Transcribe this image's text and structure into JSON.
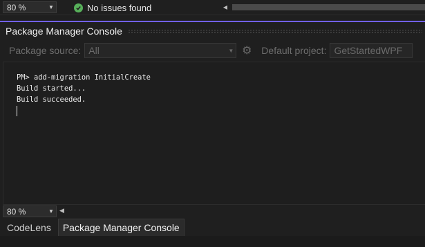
{
  "editor_status": {
    "zoom": "80 %",
    "issues_text": "No issues found"
  },
  "tool_window": {
    "title": "Package Manager Console",
    "package_source_label": "Package source:",
    "package_source_value": "All",
    "default_project_label": "Default project:",
    "default_project_value": "GetStartedWPF"
  },
  "console": {
    "lines": [
      "PM> add-migration InitialCreate",
      "Build started...",
      "Build succeeded."
    ]
  },
  "console_zoom": "80 %",
  "tabs": [
    {
      "label": "CodeLens",
      "active": false
    },
    {
      "label": "Package Manager Console",
      "active": true
    }
  ],
  "colors": {
    "accent": "#7160e8",
    "success": "#57b05a",
    "background": "#1f1f1f"
  }
}
